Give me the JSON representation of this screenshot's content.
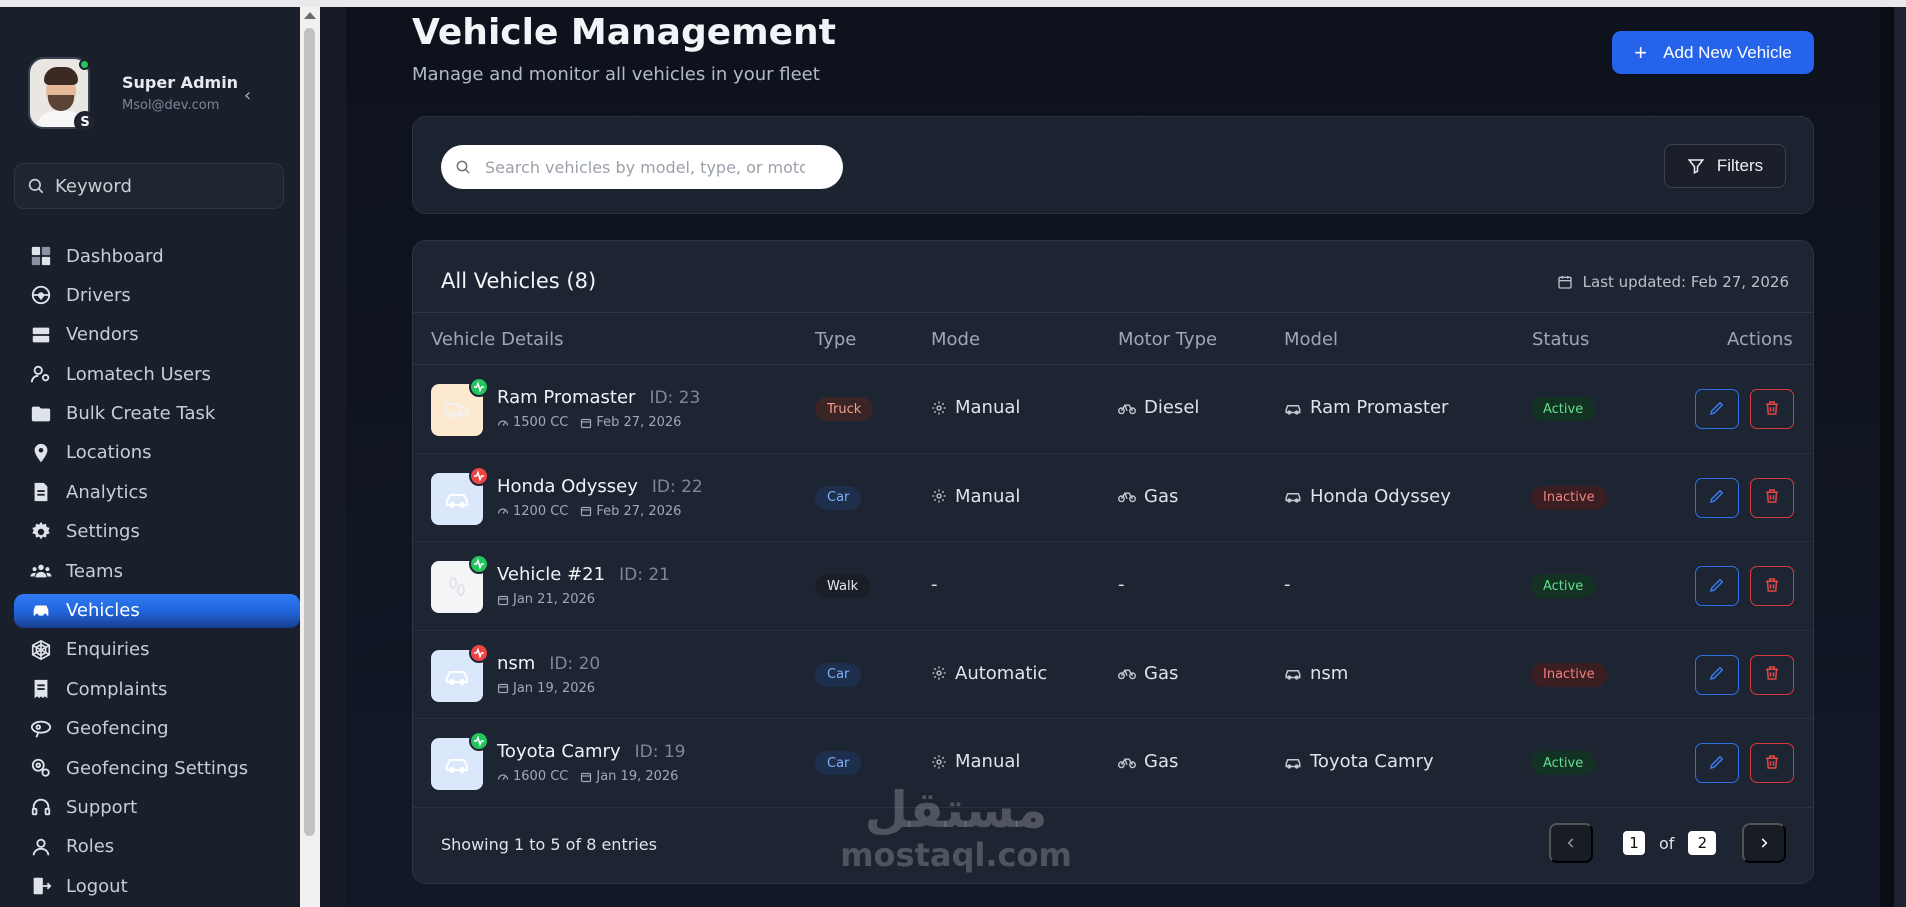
{
  "profile": {
    "name": "Super Admin",
    "email": "Msol@dev.com",
    "initial": "S"
  },
  "sidebar": {
    "search_placeholder": "Keyword",
    "items": [
      {
        "label": "Dashboard",
        "icon": "dashboard-icon",
        "active": false
      },
      {
        "label": "Drivers",
        "icon": "drivers-icon",
        "active": false
      },
      {
        "label": "Vendors",
        "icon": "vendors-icon",
        "active": false
      },
      {
        "label": "Lomatech Users",
        "icon": "users-icon",
        "active": false
      },
      {
        "label": "Bulk Create Task",
        "icon": "folder-icon",
        "active": false
      },
      {
        "label": "Locations",
        "icon": "location-pin-icon",
        "active": false
      },
      {
        "label": "Analytics",
        "icon": "document-icon",
        "active": false
      },
      {
        "label": "Settings",
        "icon": "gear-icon",
        "active": false
      },
      {
        "label": "Teams",
        "icon": "team-icon",
        "active": false
      },
      {
        "label": "Vehicles",
        "icon": "car-icon",
        "active": true
      },
      {
        "label": "Enquiries",
        "icon": "web-icon",
        "active": false
      },
      {
        "label": "Complaints",
        "icon": "receipt-icon",
        "active": false
      },
      {
        "label": "Geofencing",
        "icon": "geofence-icon",
        "active": false
      },
      {
        "label": "Geofencing Settings",
        "icon": "geofence-settings-icon",
        "active": false
      },
      {
        "label": "Support",
        "icon": "headset-icon",
        "active": false
      },
      {
        "label": "Roles",
        "icon": "user-icon",
        "active": false
      },
      {
        "label": "Logout",
        "icon": "logout-icon",
        "active": false
      }
    ]
  },
  "header": {
    "title": "Vehicle Management",
    "subtitle": "Manage and monitor all vehicles in your fleet",
    "add_button": "Add New Vehicle"
  },
  "search": {
    "placeholder": "Search vehicles by model, type, or motor...",
    "filters_label": "Filters"
  },
  "table": {
    "title": "All Vehicles (8)",
    "last_updated": "Last updated: Feb 27, 2026",
    "columns": [
      "Vehicle Details",
      "Type",
      "Mode",
      "Motor Type",
      "Model",
      "Status",
      "Actions"
    ],
    "rows": [
      {
        "name": "Ram Promaster",
        "id": "ID: 23",
        "cc": "1500 CC",
        "date": "Feb 27, 2026",
        "type": "Truck",
        "mode": "Manual",
        "motor": "Diesel",
        "model": "Ram Promaster",
        "status": "Active",
        "health": "ok",
        "thumb": "truck"
      },
      {
        "name": "Honda Odyssey",
        "id": "ID: 22",
        "cc": "1200 CC",
        "date": "Feb 27, 2026",
        "type": "Car",
        "mode": "Manual",
        "motor": "Gas",
        "model": "Honda Odyssey",
        "status": "Inactive",
        "health": "bad",
        "thumb": "car"
      },
      {
        "name": "Vehicle #21",
        "id": "ID: 21",
        "cc": "",
        "date": "Jan 21, 2026",
        "type": "Walk",
        "mode": "-",
        "motor": "-",
        "model": "-",
        "status": "Active",
        "health": "ok",
        "thumb": "walk"
      },
      {
        "name": "nsm",
        "id": "ID: 20",
        "cc": "",
        "date": "Jan 19, 2026",
        "type": "Car",
        "mode": "Automatic",
        "motor": "Gas",
        "model": "nsm",
        "status": "Inactive",
        "health": "bad",
        "thumb": "car"
      },
      {
        "name": "Toyota Camry",
        "id": "ID: 19",
        "cc": "1600 CC",
        "date": "Jan 19, 2026",
        "type": "Car",
        "mode": "Manual",
        "motor": "Gas",
        "model": "Toyota Camry",
        "status": "Active",
        "health": "ok",
        "thumb": "car"
      }
    ]
  },
  "pagination": {
    "showing": "Showing 1 to 5 of 8 entries",
    "current": "1",
    "of_label": "of",
    "total": "2"
  },
  "watermark": {
    "arabic": "مستقل",
    "latin": "mostaql.com"
  },
  "colors": {
    "accent": "#2563eb",
    "active_green": "#22c55e",
    "inactive_red": "#ef4444",
    "truck_pill": "#3a2424",
    "car_pill": "#1e3050"
  }
}
